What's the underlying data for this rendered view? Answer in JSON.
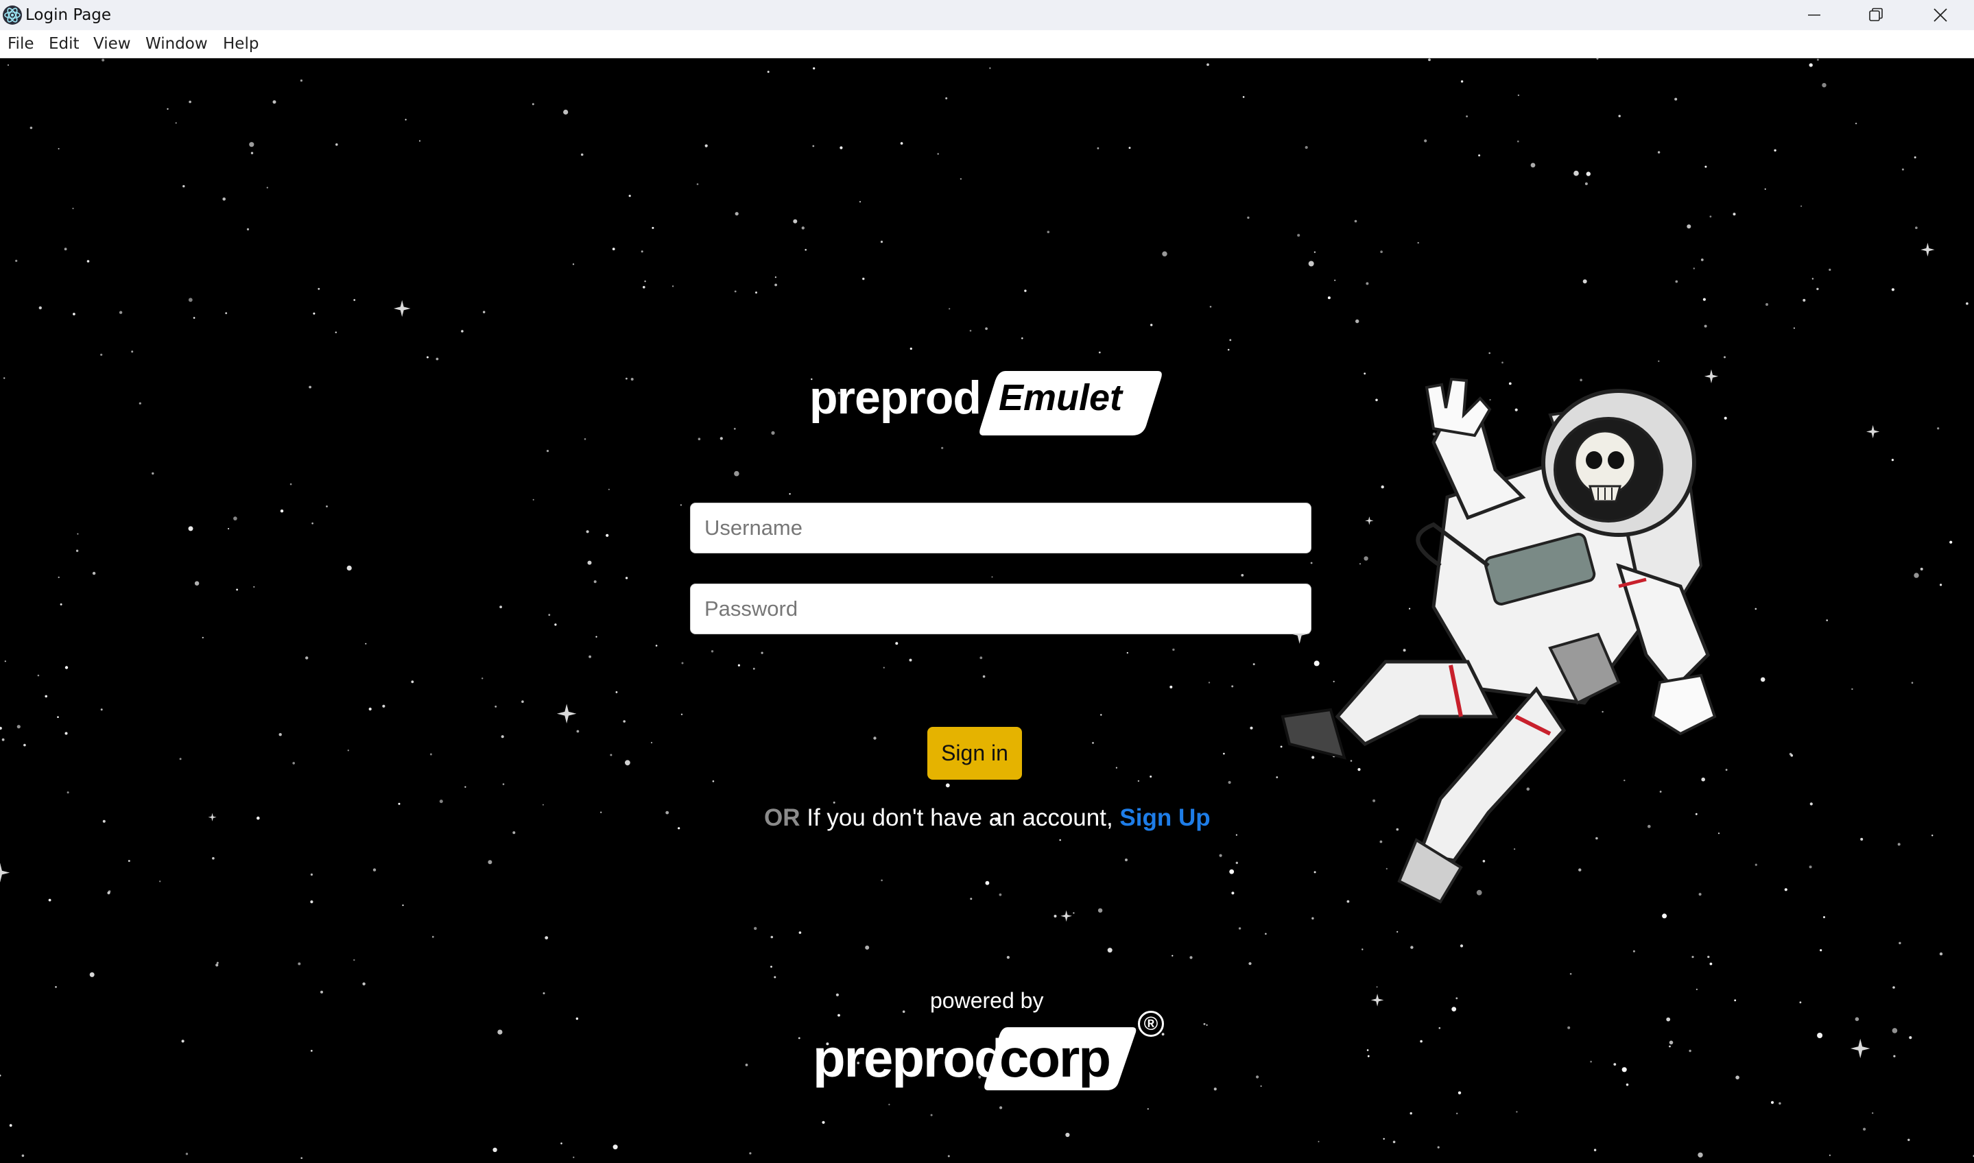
{
  "window": {
    "title": "Login Page",
    "controls": [
      "minimize-icon",
      "restore-icon",
      "close-icon"
    ]
  },
  "menu": {
    "items": [
      "File",
      "Edit",
      "View",
      "Window",
      "Help"
    ]
  },
  "logo": {
    "prefix": "preprod",
    "product": "Emulet"
  },
  "form": {
    "username_placeholder": "Username",
    "username_value": "",
    "password_placeholder": "Password",
    "password_value": "",
    "signin_label": "Sign in"
  },
  "signup": {
    "or_label": "OR",
    "text": "If you don't have an account,",
    "link_label": "Sign Up"
  },
  "footer": {
    "powered_by": "powered by",
    "brand_prefix": "preprod",
    "brand_suffix": "corp",
    "registered_mark": "®"
  },
  "colors": {
    "background": "#000000",
    "accent_button": "#e5b300",
    "link": "#1e7de8",
    "titlebar": "#eef0f5"
  }
}
